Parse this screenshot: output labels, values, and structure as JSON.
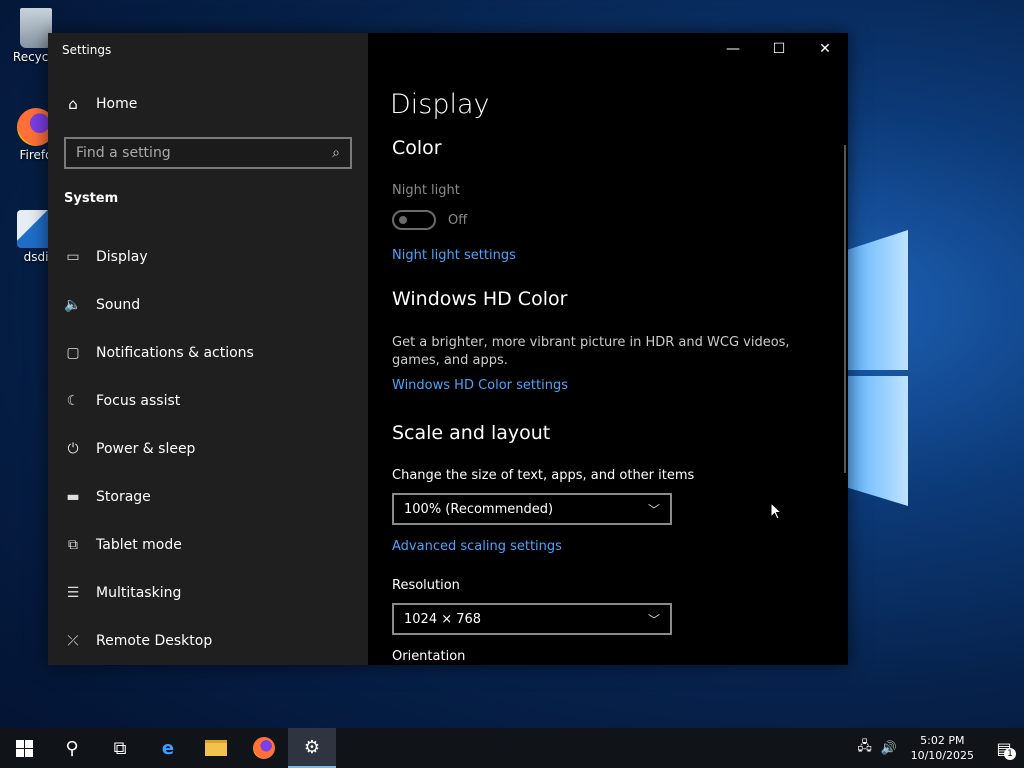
{
  "desktop": {
    "icons": [
      {
        "label": "Recycle"
      },
      {
        "label": "Firefo"
      },
      {
        "label": "dsdi"
      }
    ]
  },
  "window": {
    "title": "Settings",
    "controls": {
      "minimize": "—",
      "maximize": "☐",
      "close": "✕"
    }
  },
  "sidebar": {
    "home": "Home",
    "search_placeholder": "Find a setting",
    "section": "System",
    "items": [
      {
        "label": "Display",
        "icon": "display-icon"
      },
      {
        "label": "Sound",
        "icon": "speaker-icon"
      },
      {
        "label": "Notifications & actions",
        "icon": "notification-icon"
      },
      {
        "label": "Focus assist",
        "icon": "moon-icon"
      },
      {
        "label": "Power & sleep",
        "icon": "power-icon"
      },
      {
        "label": "Storage",
        "icon": "storage-icon"
      },
      {
        "label": "Tablet mode",
        "icon": "tablet-icon"
      },
      {
        "label": "Multitasking",
        "icon": "multitask-icon"
      },
      {
        "label": "Remote Desktop",
        "icon": "remote-desktop-icon"
      }
    ]
  },
  "main": {
    "title": "Display",
    "color_heading": "Color",
    "night_light_label": "Night light",
    "night_light_state": "Off",
    "night_light_link": "Night light settings",
    "hd_heading": "Windows HD Color",
    "hd_desc": "Get a brighter, more vibrant picture in HDR and WCG videos, games, and apps.",
    "hd_link": "Windows HD Color settings",
    "scale_heading": "Scale and layout",
    "scale_label": "Change the size of text, apps, and other items",
    "scale_value": "100% (Recommended)",
    "advanced_link": "Advanced scaling settings",
    "resolution_label": "Resolution",
    "resolution_value": "1024 × 768",
    "orientation_label": "Orientation"
  },
  "taskbar": {
    "time": "5:02 PM",
    "date": "10/10/2025",
    "notification_count": "1"
  },
  "colors": {
    "link": "#4aa3ff",
    "sidebar_bg": "#1f1f1f",
    "content_bg": "#000000",
    "taskbar_bg": "#101318"
  }
}
